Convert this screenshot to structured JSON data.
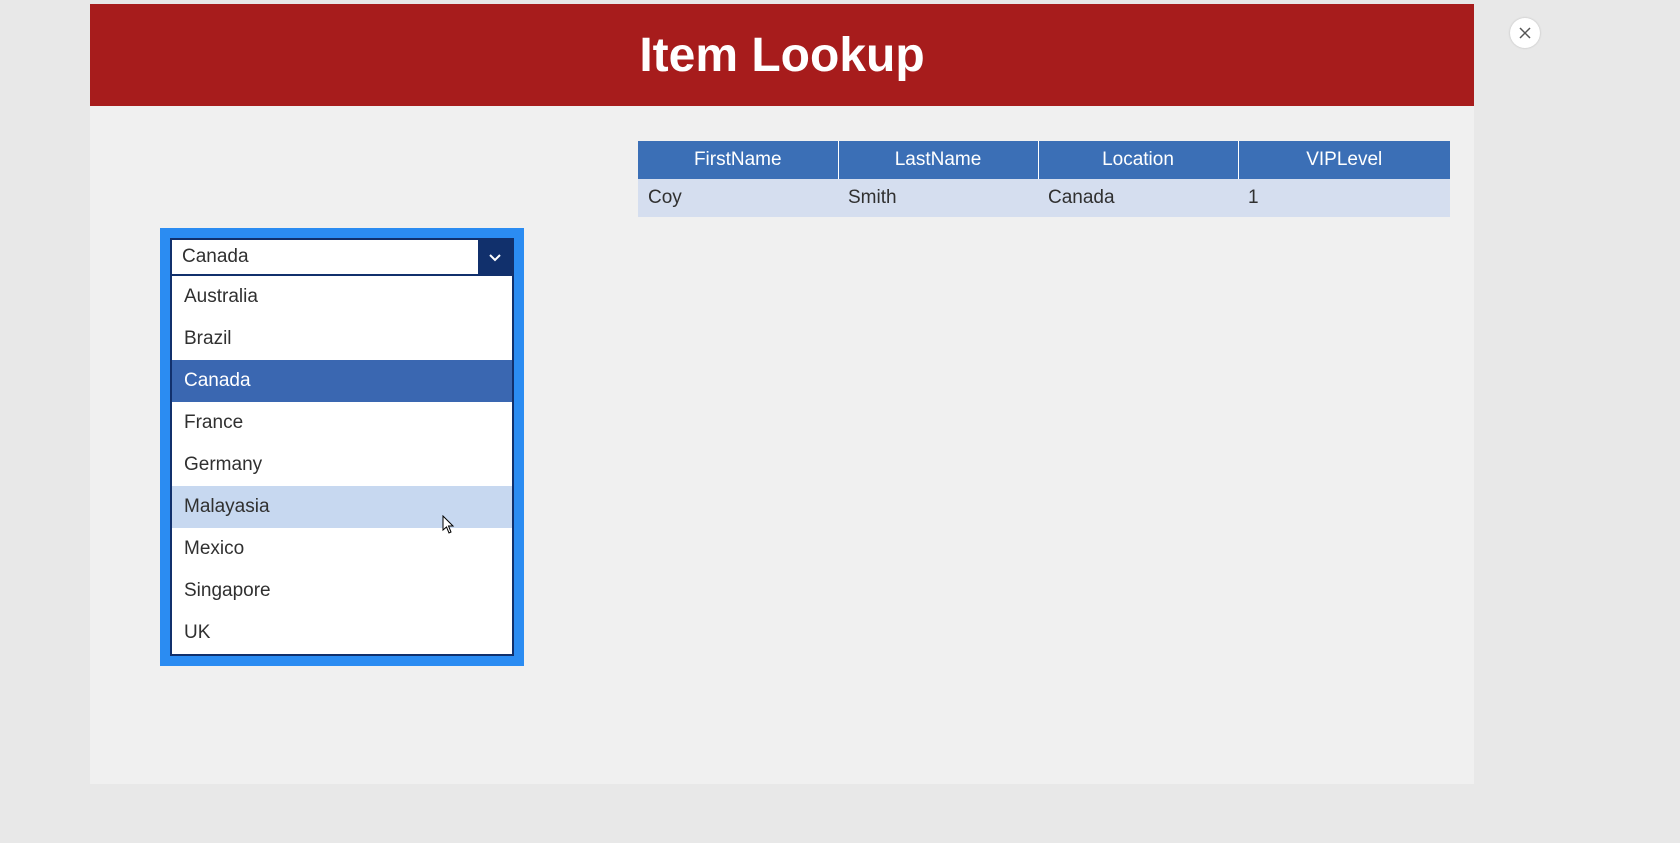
{
  "header": {
    "title": "Item Lookup"
  },
  "table": {
    "columns": [
      "FirstName",
      "LastName",
      "Location",
      "VIPLevel"
    ],
    "rows": [
      {
        "FirstName": "Coy",
        "LastName": "Smith",
        "Location": "Canada",
        "VIPLevel": "1"
      }
    ]
  },
  "dropdown": {
    "selected_value": "Canada",
    "options": [
      {
        "label": "Australia",
        "state": ""
      },
      {
        "label": "Brazil",
        "state": ""
      },
      {
        "label": "Canada",
        "state": "selected"
      },
      {
        "label": "France",
        "state": ""
      },
      {
        "label": "Germany",
        "state": ""
      },
      {
        "label": "Malayasia",
        "state": "hovered"
      },
      {
        "label": "Mexico",
        "state": ""
      },
      {
        "label": "Singapore",
        "state": ""
      },
      {
        "label": "UK",
        "state": ""
      }
    ]
  },
  "close_button": {
    "label": "×"
  }
}
